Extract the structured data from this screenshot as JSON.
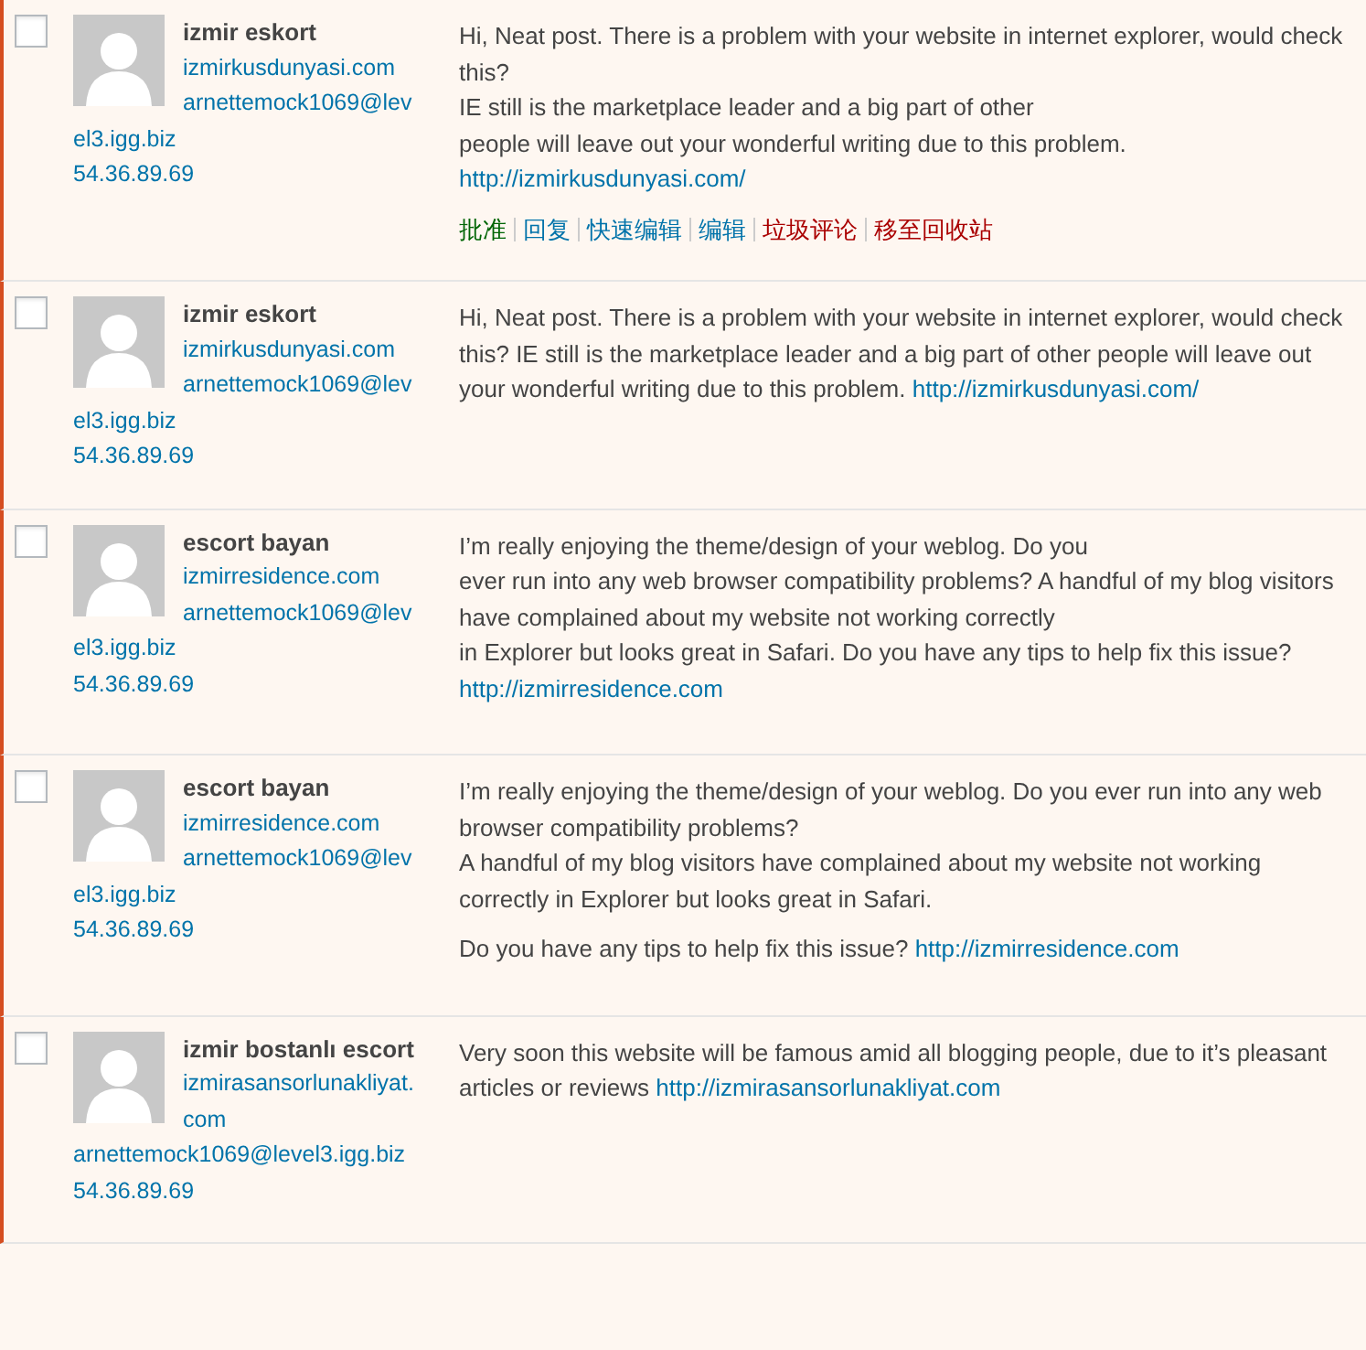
{
  "comments": [
    {
      "pending": true,
      "checked": false,
      "author": {
        "name": "izmir eskort",
        "url": "izmirkusdunyasi.com",
        "email": "arnettemock1069@level3.igg.biz",
        "ip": "54.36.89.69"
      },
      "paragraphs": [
        [
          [
            {
              "kind": "text",
              "text": "Hi, Neat post. There is a problem with your website in internet explorer, would check this?"
            }
          ],
          [
            {
              "kind": "text",
              "text": "IE still is the marketplace leader and a big part of other"
            }
          ],
          [
            {
              "kind": "text",
              "text": "people will leave out your wonderful writing due to this problem."
            }
          ],
          [
            {
              "kind": "link",
              "text": "http://izmirkusdunyasi.com/"
            }
          ]
        ]
      ],
      "actions": [
        {
          "label": "批准",
          "kind": "approve"
        },
        {
          "label": "回复",
          "kind": "normal"
        },
        {
          "label": "快速编辑",
          "kind": "normal"
        },
        {
          "label": "编辑",
          "kind": "normal"
        },
        {
          "label": "垃圾评论",
          "kind": "danger"
        },
        {
          "label": "移至回收站",
          "kind": "danger"
        }
      ]
    },
    {
      "pending": true,
      "checked": false,
      "author": {
        "name": "izmir eskort",
        "url": "izmirkusdunyasi.com",
        "email": "arnettemock1069@level3.igg.biz",
        "ip": "54.36.89.69"
      },
      "paragraphs": [
        [
          [
            {
              "kind": "text",
              "text": "Hi, Neat post. There is a problem with your website in internet explorer, would check this? IE still is the marketplace leader and a big part of other people will leave out your wonderful writing due to this problem. "
            },
            {
              "kind": "link",
              "text": "http://izmirkusdunyasi.com/"
            }
          ]
        ]
      ]
    },
    {
      "pending": true,
      "checked": false,
      "author": {
        "name": "escort bayan",
        "url": "izmirresidence.com",
        "email": "arnettemock1069@level3.igg.biz",
        "ip": "54.36.89.69"
      },
      "paragraphs": [
        [
          [
            {
              "kind": "text",
              "text": "I’m really enjoying the theme/design of your weblog. Do you"
            }
          ],
          [
            {
              "kind": "text",
              "text": "ever run into any web browser compatibility problems? A handful of my blog visitors have complained about my website not working correctly"
            }
          ],
          [
            {
              "kind": "text",
              "text": "in Explorer but looks great in Safari. Do you have any tips to help fix this issue?"
            }
          ],
          [
            {
              "kind": "link",
              "text": "http://izmirresidence.com"
            }
          ]
        ]
      ]
    },
    {
      "pending": true,
      "checked": false,
      "author": {
        "name": "escort bayan",
        "url": "izmirresidence.com",
        "email": "arnettemock1069@level3.igg.biz",
        "ip": "54.36.89.69"
      },
      "paragraphs": [
        [
          [
            {
              "kind": "text",
              "text": "I’m really enjoying the theme/design of your weblog. Do you ever run into any web browser compatibility problems?"
            }
          ],
          [
            {
              "kind": "text",
              "text": "A handful of my blog visitors have complained about my website not working correctly in Explorer but looks great in Safari."
            }
          ]
        ],
        [
          [
            {
              "kind": "text",
              "text": "Do you have any tips to help fix this issue? "
            },
            {
              "kind": "link",
              "text": "http://izmirresidence.com"
            }
          ]
        ]
      ]
    },
    {
      "pending": true,
      "checked": false,
      "author": {
        "name": "izmir bostanlı escort",
        "url": "izmirasansorlunakliyat.com",
        "email": "arnettemock1069@level3.igg.biz",
        "ip": "54.36.89.69"
      },
      "paragraphs": [
        [
          [
            {
              "kind": "text",
              "text": "Very soon this website will be famous amid all blogging people, due to it’s pleasant articles or reviews "
            },
            {
              "kind": "link",
              "text": "http://izmirasansorlunakliyat.com"
            }
          ]
        ]
      ]
    }
  ]
}
